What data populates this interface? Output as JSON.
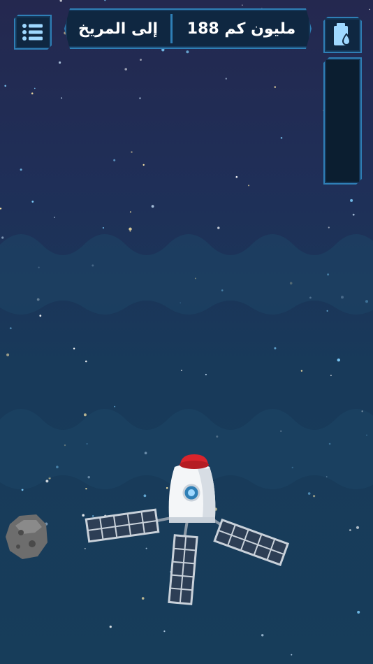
{
  "hud": {
    "distance_value": "188 مليون كم",
    "destination": "إلى المريخ"
  },
  "icons": {
    "menu": "list-menu-icon",
    "fuel": "fuel-tank-icon"
  },
  "fuel_level": 0,
  "colors": {
    "hud_border": "#2f7fb6",
    "hud_fill": "#0f2741",
    "rocket_cap": "#d9242c"
  }
}
